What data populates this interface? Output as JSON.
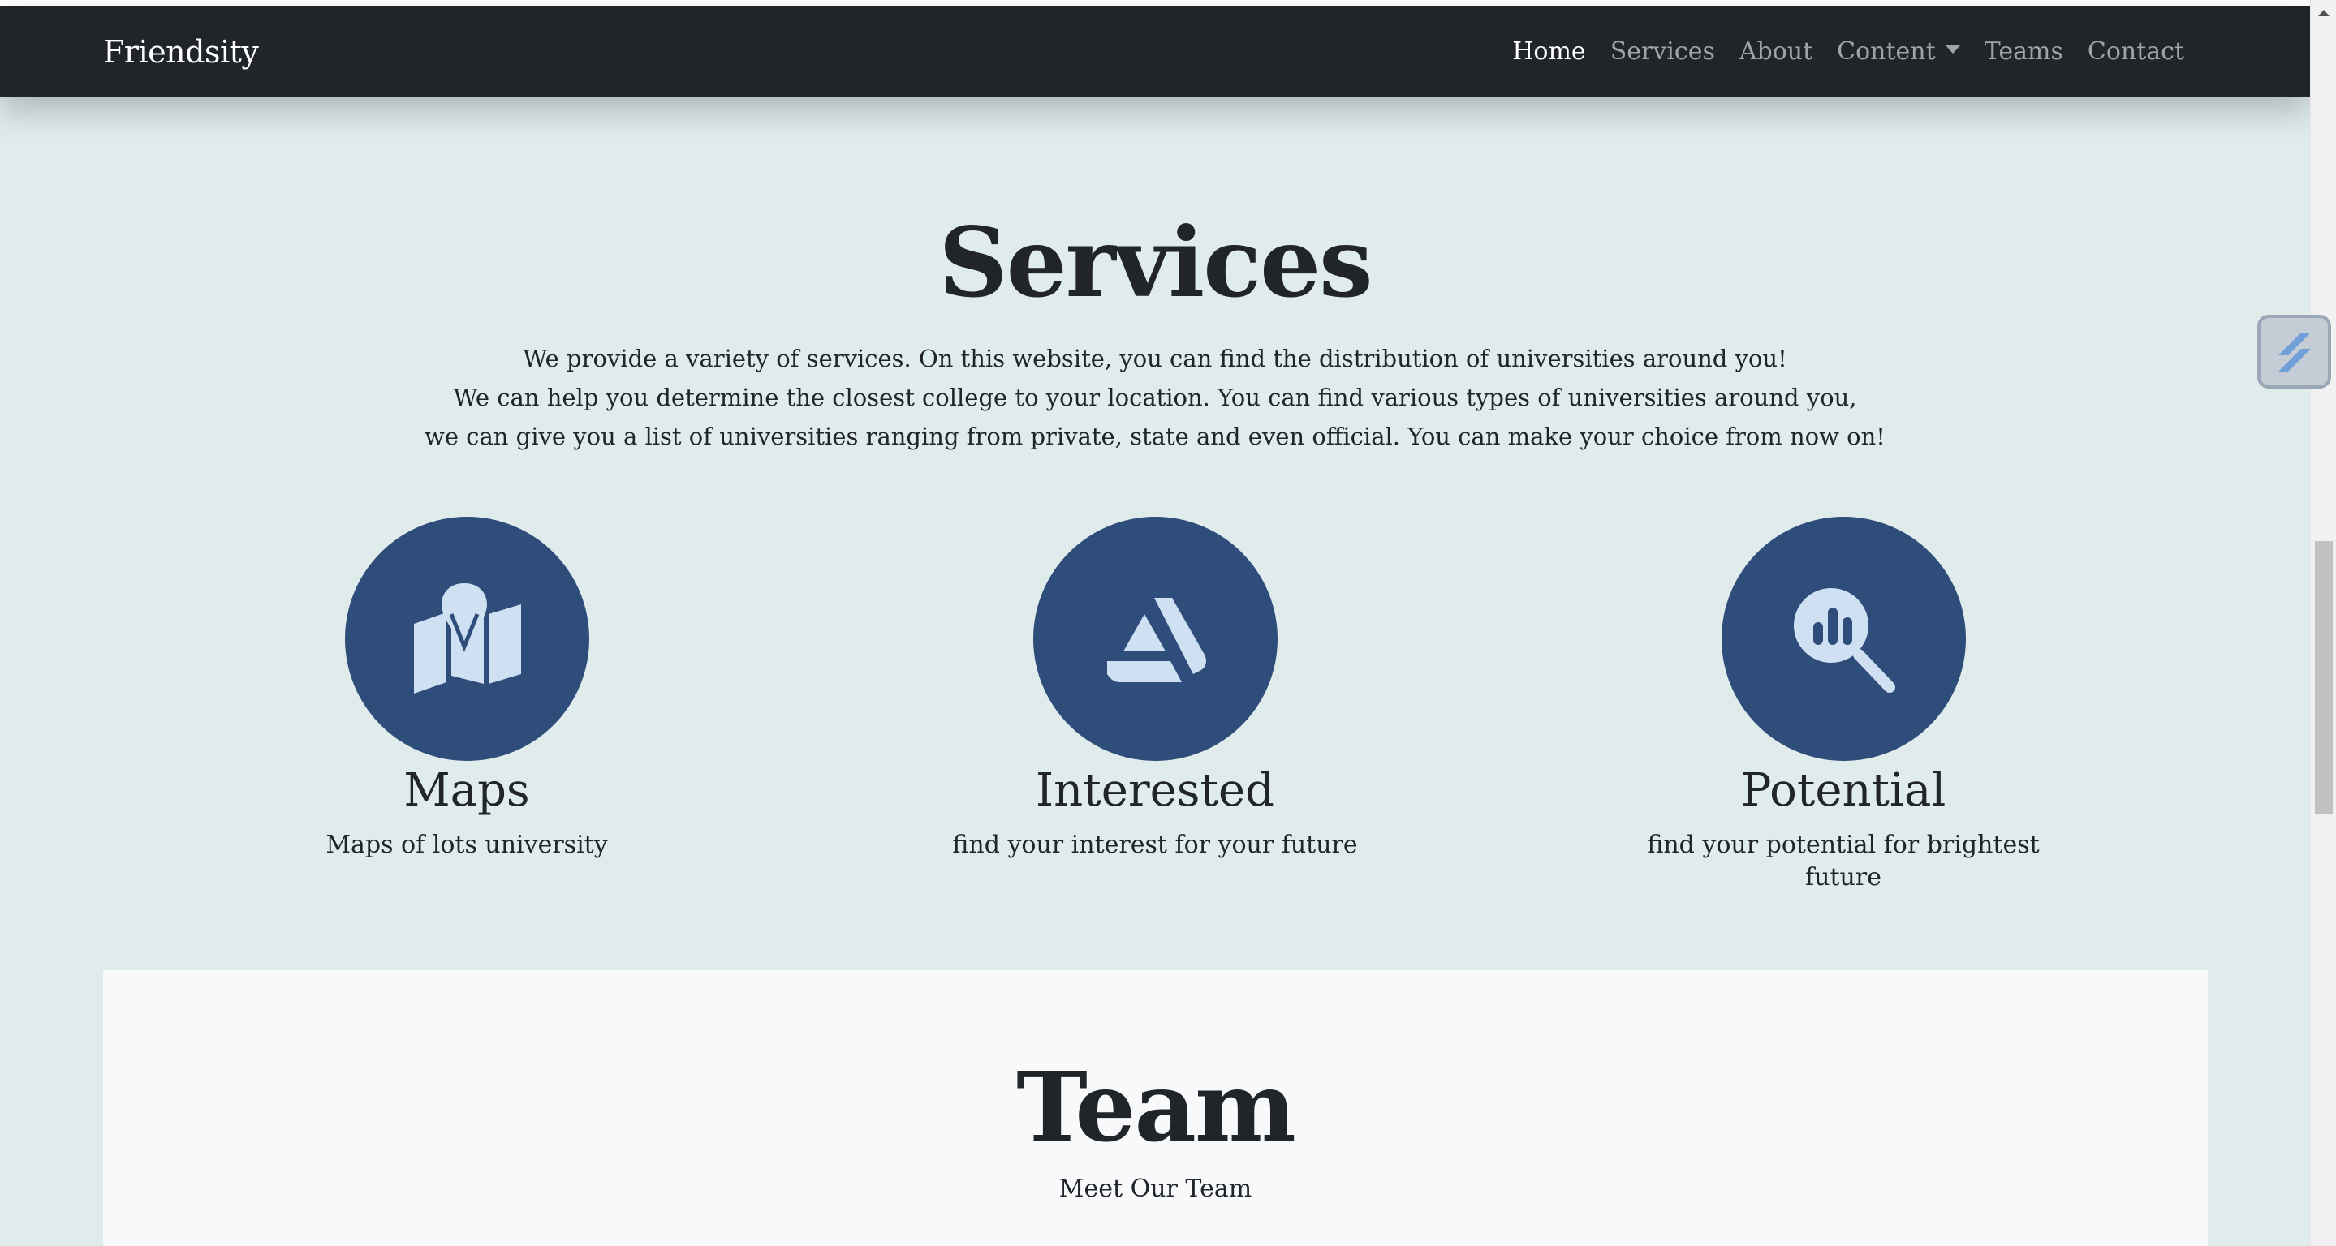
{
  "navbar": {
    "brand": "Friendsity",
    "links": [
      {
        "label": "Home",
        "active": true
      },
      {
        "label": "Services",
        "active": false
      },
      {
        "label": "About",
        "active": false
      },
      {
        "label": "Content",
        "active": false,
        "dropdown": true
      },
      {
        "label": "Teams",
        "active": false
      },
      {
        "label": "Contact",
        "active": false
      }
    ]
  },
  "services": {
    "title": "Services",
    "description": [
      "We provide a variety of services. On this website, you can find the distribution of universities around you!",
      "We can help you determine the closest college to your location. You can find various types of universities around you,",
      "we can give you a list of universities ranging from private, state and even official. You can make your choice from now on!"
    ],
    "cards": [
      {
        "icon": "map-icon",
        "title": "Maps",
        "text": "Maps of lots university"
      },
      {
        "icon": "artstation-icon",
        "title": "Interested",
        "text": "find your interest for your future"
      },
      {
        "icon": "search-chart-icon",
        "title": "Potential",
        "text": "find your potential for brightest future"
      }
    ]
  },
  "team": {
    "title": "Team",
    "subtitle": "Meet Our Team"
  },
  "colors": {
    "navbar_bg": "#212529",
    "page_bg": "#e0ecec",
    "icon_circle": "#2f4d7a",
    "icon_fill": "#cfe0f3",
    "team_bg": "#f7f9fb"
  }
}
